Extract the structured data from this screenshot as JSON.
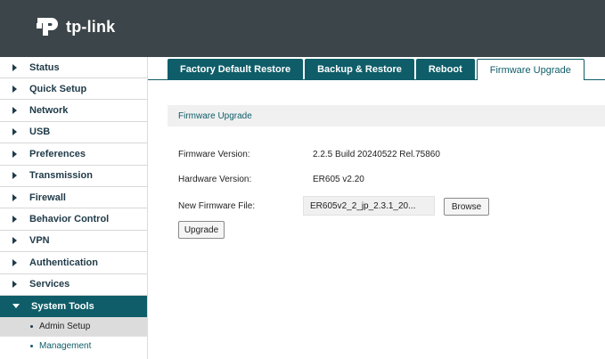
{
  "header": {
    "brand": "tp-link"
  },
  "sidebar": {
    "items": [
      {
        "label": "Status"
      },
      {
        "label": "Quick Setup"
      },
      {
        "label": "Network"
      },
      {
        "label": "USB"
      },
      {
        "label": "Preferences"
      },
      {
        "label": "Transmission"
      },
      {
        "label": "Firewall"
      },
      {
        "label": "Behavior Control"
      },
      {
        "label": "VPN"
      },
      {
        "label": "Authentication"
      },
      {
        "label": "Services"
      },
      {
        "label": "System Tools"
      }
    ],
    "active_item": "System Tools",
    "subitems": [
      {
        "label": "Admin Setup",
        "selected": true
      },
      {
        "label": "Management",
        "selected": false
      }
    ]
  },
  "tabs": [
    {
      "label": "Factory Default Restore"
    },
    {
      "label": "Backup & Restore"
    },
    {
      "label": "Reboot"
    },
    {
      "label": "Firmware Upgrade"
    }
  ],
  "active_tab": "Firmware Upgrade",
  "section": {
    "title": "Firmware Upgrade"
  },
  "fields": {
    "firmware_version_label": "Firmware Version:",
    "firmware_version_value": "2.2.5 Build 20240522 Rel.75860",
    "hardware_version_label": "Hardware Version:",
    "hardware_version_value": "ER605 v2.20",
    "new_firmware_label": "New Firmware File:",
    "new_firmware_value": "ER605v2_2_jp_2.3.1_20..."
  },
  "buttons": {
    "browse": "Browse",
    "upgrade": "Upgrade"
  },
  "colors": {
    "header_bg": "#3c4549",
    "accent": "#0f5d69"
  }
}
